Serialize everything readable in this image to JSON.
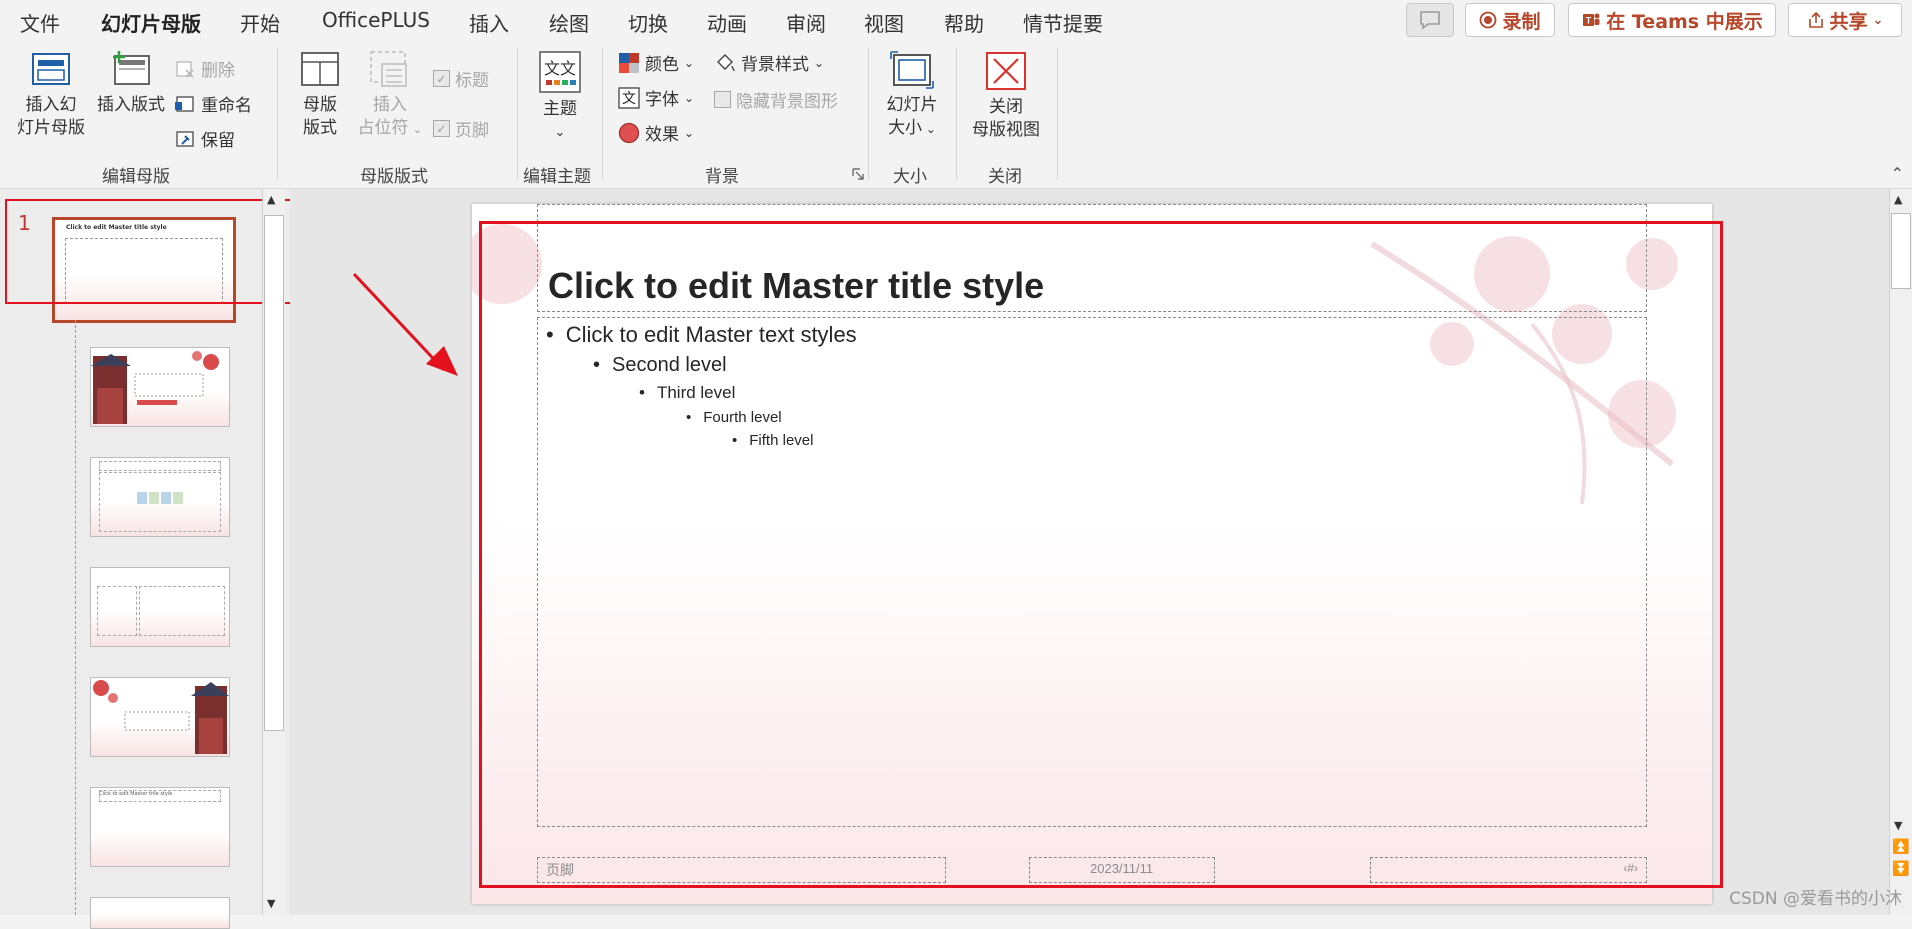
{
  "menu": {
    "tabs": [
      "文件",
      "幻灯片母版",
      "开始",
      "OfficePLUS",
      "插入",
      "绘图",
      "切换",
      "动画",
      "审阅",
      "视图",
      "帮助",
      "情节提要"
    ],
    "active_tab": "幻灯片母版",
    "record_label": "录制",
    "teams_label": "在 Teams 中展示",
    "share_label": "共享"
  },
  "ribbon": {
    "edit_master": {
      "insert_master_line1": "插入幻",
      "insert_master_line2": "灯片母版",
      "insert_layout": "插入版式",
      "delete": "删除",
      "rename": "重命名",
      "preserve": "保留",
      "group_label": "编辑母版"
    },
    "master_layout": {
      "master_layout_line1": "母版",
      "master_layout_line2": "版式",
      "insert_placeholder_line1": "插入",
      "insert_placeholder_line2": "占位符",
      "title_check": "标题",
      "footer_check": "页脚",
      "group_label": "母版版式"
    },
    "edit_theme": {
      "themes": "主题",
      "group_label": "编辑主题"
    },
    "background": {
      "colors": "颜色",
      "fonts": "字体",
      "effects": "效果",
      "background_styles": "背景样式",
      "hide_background_graphics": "隐藏背景图形",
      "group_label": "背景"
    },
    "size": {
      "slide_size_line1": "幻灯片",
      "slide_size_line2": "大小",
      "group_label": "大小"
    },
    "close": {
      "close_line1": "关闭",
      "close_line2": "母版视图",
      "group_label": "关闭"
    }
  },
  "thumbnails": {
    "first_number": "1",
    "master_title": "Click to edit Master title style",
    "layout2_title": "Click to edit Master title style"
  },
  "slide": {
    "title": "Click to edit Master title style",
    "levels": [
      "Click to edit Master text styles",
      "Second level",
      "Third level",
      "Fourth level",
      "Fifth level"
    ],
    "footer": "页脚",
    "date": "2023/11/11",
    "page_number_symbol": "‹#›"
  },
  "watermark": "CSDN @爱看书的小沐",
  "colors": {
    "accent": "#b7472a",
    "annotation_red": "#e3101e"
  }
}
